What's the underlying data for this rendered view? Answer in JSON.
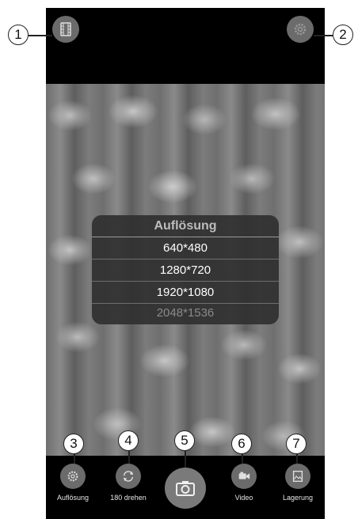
{
  "resolution_popup": {
    "title": "Auflösung",
    "options": [
      "640*480",
      "1280*720",
      "1920*1080",
      "2048*1536"
    ]
  },
  "toolbar": {
    "resolution_label": "Auflösung",
    "rotate_label": "180 drehen",
    "video_label": "Video",
    "storage_label": "Lagerung"
  },
  "callouts": [
    "1",
    "2",
    "3",
    "4",
    "5",
    "6",
    "7"
  ],
  "icons": {
    "top_left": "film-strip-icon",
    "top_right": "gear-icon",
    "resolution": "gear-icon",
    "rotate": "rotate-icon",
    "capture": "camera-icon",
    "video": "video-camera-icon",
    "storage": "image-gallery-icon"
  },
  "colors": {
    "background": "#000000",
    "button_gray": "#6b6b6b",
    "popup_bg": "#303030"
  }
}
